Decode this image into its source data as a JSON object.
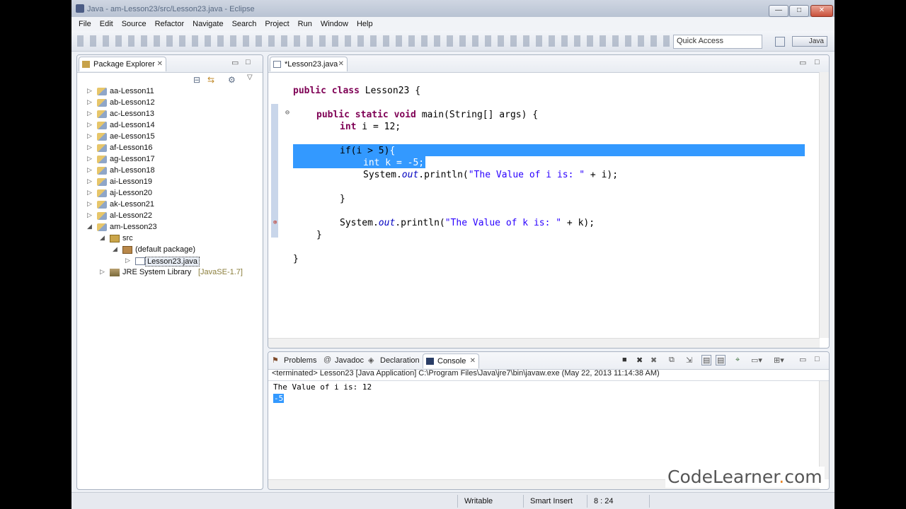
{
  "window": {
    "title": "Java - am-Lesson23/src/Lesson23.java - Eclipse",
    "controls": {
      "minimize": "—",
      "maximize": "□",
      "close": "✕"
    }
  },
  "menu": [
    "File",
    "Edit",
    "Source",
    "Refactor",
    "Navigate",
    "Search",
    "Project",
    "Run",
    "Window",
    "Help"
  ],
  "toolbar": {
    "quick_access_placeholder": "Quick Access",
    "perspective_label": "Java"
  },
  "package_explorer": {
    "title": "Package Explorer",
    "projects": [
      "aa-Lesson11",
      "ab-Lesson12",
      "ac-Lesson13",
      "ad-Lesson14",
      "ae-Lesson15",
      "af-Lesson16",
      "ag-Lesson17",
      "ah-Lesson18",
      "ai-Lesson19",
      "aj-Lesson20",
      "ak-Lesson21",
      "al-Lesson22",
      "am-Lesson23"
    ],
    "src": "src",
    "package": "(default package)",
    "file": "Lesson23.java",
    "jre": "JRE System Library",
    "jre_version": "[JavaSE-1.7]"
  },
  "editor": {
    "tab_title": "*Lesson23.java",
    "code": {
      "l1_kw": "public class",
      "l1_rest": " Lesson23 {",
      "l2_kw": "public static void",
      "l2_rest": " main(String[] args) {",
      "l3_kw": "int",
      "l3_rest": " i = 12;",
      "l4_pre": "if(i > 5)",
      "l4_sel": "{",
      "l5_sel": "int k = -5;",
      "l6_pre": "System.",
      "l6_it": "out",
      "l6_mid": ".println(",
      "l6_str": "\"The Value of i is: \"",
      "l6_end": " + i);",
      "l7": "}",
      "l8_pre": "System.",
      "l8_it": "out",
      "l8_mid": ".println(",
      "l8_str": "\"The Value of k is: \"",
      "l8_end": " + k);",
      "l9": "}",
      "l10": "}"
    }
  },
  "console": {
    "tabs": [
      "Problems",
      "Javadoc",
      "Declaration",
      "Console"
    ],
    "active_tab": "Console",
    "terminated": "<terminated> Lesson23 [Java Application] C:\\Program Files\\Java\\jre7\\bin\\javaw.exe (May 22, 2013 11:14:38 AM)",
    "output_line": "The Value of i is: 12",
    "selected_output": "-5"
  },
  "status": {
    "writable": "Writable",
    "insert_mode": "Smart Insert",
    "position": "8 : 24"
  },
  "watermark": {
    "main": "CodeLearner",
    "dot": ".",
    "tld": "com"
  }
}
